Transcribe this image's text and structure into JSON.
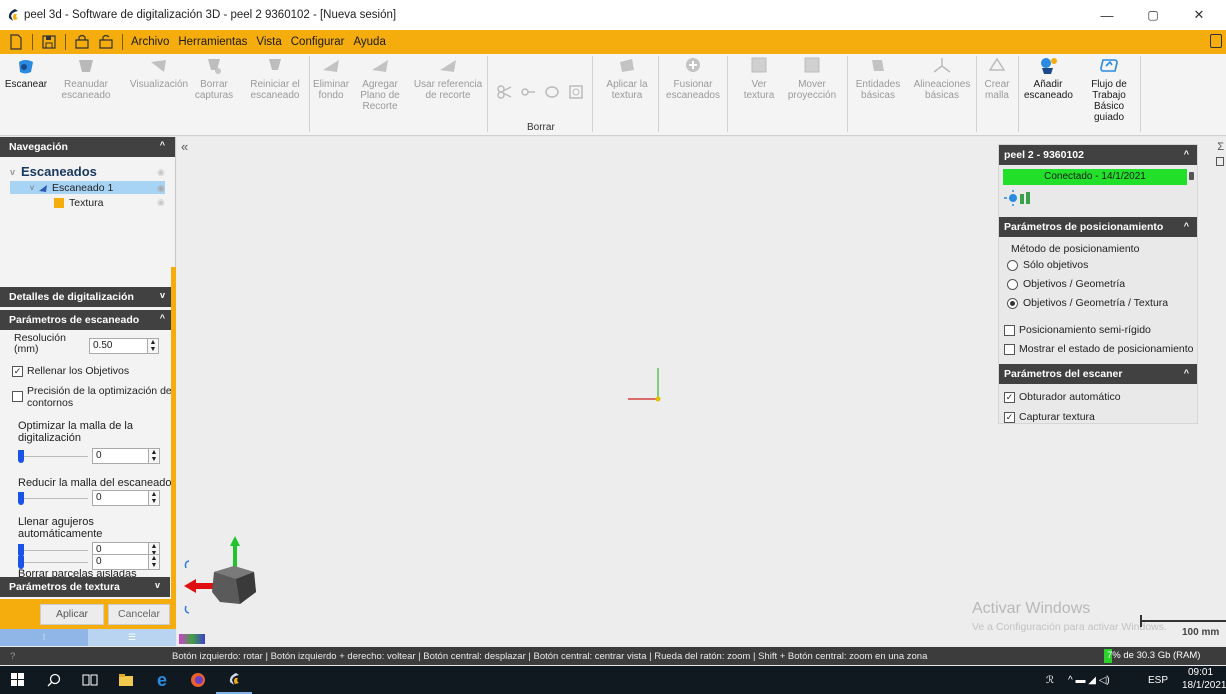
{
  "window": {
    "title": "peel 3d - Software de digitalización 3D - peel 2 9360102 - [Nueva sesión]",
    "minimize": "—",
    "maximize": "▢",
    "close": "✕"
  },
  "menu": [
    "Archivo",
    "Herramientas",
    "Vista",
    "Configurar",
    "Ayuda"
  ],
  "ribbon": {
    "buttons": [
      {
        "label": "Escanear",
        "enabled": true,
        "icon": "scan-icon"
      },
      {
        "label": "Reanudar escaneado",
        "enabled": false,
        "icon": "resume-scan-icon"
      },
      {
        "label": "Visualización",
        "enabled": false,
        "icon": "visualization-icon"
      },
      {
        "label": "Borrar capturas",
        "enabled": false,
        "icon": "clear-captures-icon"
      },
      {
        "label": "Reiniciar el escaneado",
        "enabled": false,
        "icon": "restart-scan-icon"
      },
      {
        "label": "Eliminar fondo",
        "enabled": false,
        "icon": "remove-background-icon"
      },
      {
        "label": "Agregar Plano de Recorte",
        "enabled": false,
        "icon": "add-clipping-plane-icon"
      },
      {
        "label": "Usar referencia de recorte",
        "enabled": false,
        "icon": "clip-reference-icon"
      },
      {
        "label": "Aplicar la textura",
        "enabled": false,
        "icon": "apply-texture-icon"
      },
      {
        "label": "Fusionar escaneados",
        "enabled": false,
        "icon": "merge-scans-icon"
      },
      {
        "label": "Ver textura",
        "enabled": false,
        "icon": "view-texture-icon"
      },
      {
        "label": "Mover proyección",
        "enabled": false,
        "icon": "move-projection-icon"
      },
      {
        "label": "Entidades básicas",
        "enabled": false,
        "icon": "basic-entities-icon"
      },
      {
        "label": "Alineaciones básicas",
        "enabled": false,
        "icon": "basic-alignments-icon"
      },
      {
        "label": "Crear malla",
        "enabled": false,
        "icon": "create-mesh-icon"
      },
      {
        "label": "Añadir escaneado",
        "enabled": true,
        "icon": "add-scan-icon"
      },
      {
        "label": "Flujo de Trabajo Básico guiado",
        "enabled": true,
        "icon": "guided-workflow-icon"
      }
    ],
    "borrar_group": "Borrar"
  },
  "navigation": {
    "title": "Navegación",
    "root": "Escaneados",
    "scan": "Escaneado 1",
    "texture": "Textura"
  },
  "details": {
    "title": "Detalles de digitalización"
  },
  "scan_params": {
    "title": "Parámetros de escaneado",
    "resolution_label": "Resolución (mm)",
    "resolution_value": "0.50",
    "fill_targets": "Rellenar los Objetivos",
    "fill_targets_checked": true,
    "contour_precision": "Precisión de la optimización de contornos",
    "contour_checked": false,
    "optimize_mesh": "Optimizar la malla de la digitalización",
    "optimize_value": "0",
    "reduce_mesh": "Reducir la malla del escaneado",
    "reduce_value": "0",
    "fill_holes": "Llenar agujeros automáticamente",
    "fill_holes_value": "0",
    "remove_isolated": "Borrar parcelas aisladas",
    "remove_isolated_value": "0"
  },
  "texture_params": {
    "title": "Parámetros de textura"
  },
  "actions": {
    "apply": "Aplicar",
    "cancel": "Cancelar"
  },
  "device": {
    "title": "peel 2 - 9360102",
    "status": "Conectado - 14/1/2021",
    "status_color": "#22e02a"
  },
  "positioning": {
    "title": "Parámetros de posicionamiento",
    "method_label": "Método de posicionamiento",
    "options": [
      "Sólo objetivos",
      "Objetivos / Geometría",
      "Objetivos / Geometría / Textura"
    ],
    "selected_index": 2,
    "semi_rigid": "Posicionamiento semi-rígido",
    "show_state": "Mostrar el estado de posicionamiento"
  },
  "scanner_params": {
    "title": "Parámetros del escaner",
    "auto_shutter": "Obturador automático",
    "capture_texture": "Capturar textura"
  },
  "watermark": {
    "title": "Activar Windows",
    "subtitle": "Ve a Configuración para activar Windows."
  },
  "scale_label": "100 mm",
  "status_bar": {
    "hint": "Botón izquierdo: rotar | Botón izquierdo + derecho: voltear | Botón central: desplazar | Botón central: centrar vista | Rueda del ratón: zoom | Shift + Botón central: zoom en una zona",
    "memory": "7% de 30.3 Gb (RAM)",
    "memory_percent": 7
  },
  "taskbar": {
    "lang": "ESP",
    "time": "09:01",
    "date": "18/1/2021"
  },
  "colors": {
    "accent": "#f5ad0d",
    "panel_header": "#414141",
    "selection": "#a7d3f5"
  }
}
